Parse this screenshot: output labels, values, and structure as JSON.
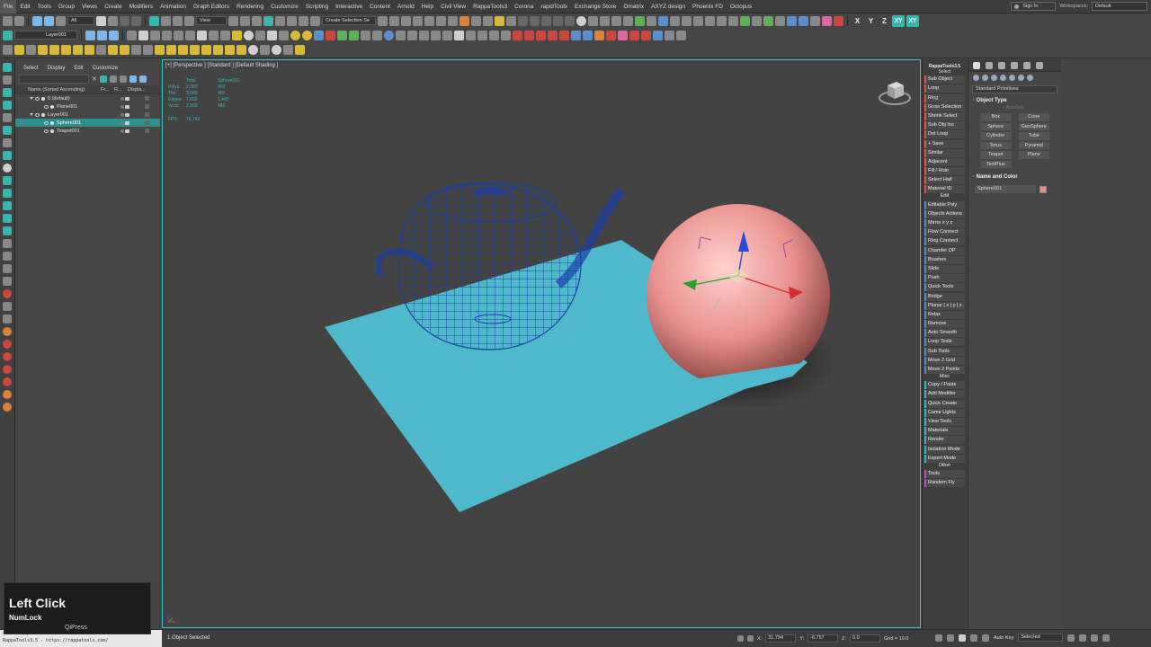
{
  "menu": [
    "File",
    "Edit",
    "Tools",
    "Group",
    "Views",
    "Create",
    "Modifiers",
    "Animation",
    "Graph Editors",
    "Rendering",
    "Customize",
    "Scripting",
    "Interactive",
    "Content",
    "Arnold",
    "Help",
    "Civil View",
    "RappaTools3",
    "Corona",
    "rapidTools",
    "Exchange Store",
    "Omatrix",
    "AXYZ design",
    "Phoenix FD",
    "Octopus"
  ],
  "account": {
    "sign_in": "Sign In",
    "workspaces_label": "Workspaces:",
    "workspace": "Default"
  },
  "toolbar": {
    "filter": "All",
    "ref_coord": "View",
    "selection_set": "Create Selection Se",
    "layer": "Layer001",
    "axes": [
      "X",
      "Y",
      "Z",
      "XY",
      "XY"
    ]
  },
  "explorer": {
    "menu": [
      "Select",
      "Display",
      "Edit",
      "Customize"
    ],
    "columns": {
      "name": "Name (Sorted Ascending)",
      "frozen": "Fr...",
      "render": "R...",
      "display": "Displa..."
    },
    "rows": [
      {
        "label": "0 (default)",
        "indent": 1,
        "selected": false
      },
      {
        "label": "Plane001",
        "indent": 2,
        "selected": false
      },
      {
        "label": "Layer001",
        "indent": 1,
        "selected": false
      },
      {
        "label": "Sphere001",
        "indent": 2,
        "selected": true
      },
      {
        "label": "Teapot001",
        "indent": 2,
        "selected": false
      }
    ]
  },
  "viewport": {
    "label": "[+] [Perspective ] [Standard ] [Default Shading ]",
    "stats": {
      "header": [
        "",
        "Total",
        "Sphere001"
      ],
      "rows": [
        [
          "Polys:",
          "2,080",
          "960"
        ],
        [
          "Tris:",
          "3,680",
          "960"
        ],
        [
          "Edges:",
          "7,600",
          "1,440"
        ],
        [
          "Verts:",
          "2,589",
          "482"
        ]
      ],
      "fps_label": "FPS:",
      "fps": "76.742"
    }
  },
  "rappa": {
    "title": "RappaTools3.5",
    "subtitle": "Select",
    "items": [
      {
        "type": "btn",
        "label": "Sub Object",
        "color": "red"
      },
      {
        "type": "btn",
        "label": "Loop",
        "color": "red"
      },
      {
        "type": "btn",
        "label": "Ring",
        "color": "red"
      },
      {
        "type": "btn",
        "label": "Grow Selection",
        "color": "red"
      },
      {
        "type": "btn",
        "label": "Shrink Select",
        "color": "red"
      },
      {
        "type": "btn",
        "label": "Sub Obj Iso",
        "color": "red"
      },
      {
        "type": "btn",
        "label": "Dot Loop",
        "color": "red"
      },
      {
        "type": "btn",
        "label": "+ Save",
        "color": "red"
      },
      {
        "type": "btn",
        "label": "Similar",
        "color": "red"
      },
      {
        "type": "btn",
        "label": "Adjacent",
        "color": "red"
      },
      {
        "type": "btn",
        "label": "Fill / Hole",
        "color": "red"
      },
      {
        "type": "btn",
        "label": "Select Half",
        "color": "red"
      },
      {
        "type": "btn",
        "label": "Material ID",
        "color": "red"
      },
      {
        "type": "sect",
        "label": "Edit"
      },
      {
        "type": "btn",
        "label": "Editable Poly",
        "color": "blue"
      },
      {
        "type": "btn",
        "label": "Objects Actions",
        "color": "blue"
      },
      {
        "type": "btn",
        "label": "Mirror   x  y  z",
        "color": "blue"
      },
      {
        "type": "btn",
        "label": "Flow Connect",
        "color": "blue"
      },
      {
        "type": "btn",
        "label": "Ring Connect",
        "color": "blue"
      },
      {
        "type": "btn",
        "label": "Chamfer OP",
        "color": "blue"
      },
      {
        "type": "btn",
        "label": "Brushes",
        "color": "blue"
      },
      {
        "type": "btn",
        "label": "Slide",
        "color": "blue"
      },
      {
        "type": "btn",
        "label": "Push",
        "color": "blue"
      },
      {
        "type": "btn",
        "label": "Quick Tools",
        "color": "blue"
      },
      {
        "type": "btn",
        "label": "Bridge",
        "color": "blue"
      },
      {
        "type": "btn",
        "label": "Planar | x | y | z",
        "color": "blue"
      },
      {
        "type": "btn",
        "label": "Relax",
        "color": "blue"
      },
      {
        "type": "btn",
        "label": "Remove",
        "color": "blue"
      },
      {
        "type": "btn",
        "label": "Auto Smooth",
        "color": "blue"
      },
      {
        "type": "btn",
        "label": "Loop Tools",
        "color": "blue"
      },
      {
        "type": "btn",
        "label": "Sub Tools",
        "color": "blue"
      },
      {
        "type": "btn",
        "label": "Move 2 Grid",
        "color": "blue"
      },
      {
        "type": "btn",
        "label": "Move 2 Points",
        "color": "blue"
      },
      {
        "type": "sect",
        "label": "Misc"
      },
      {
        "type": "btn",
        "label": "Copy / Paste",
        "color": "teal"
      },
      {
        "type": "btn",
        "label": "Add Modifier",
        "color": "teal"
      },
      {
        "type": "btn",
        "label": "Quick Create",
        "color": "teal"
      },
      {
        "type": "btn",
        "label": "Came Lights",
        "color": "teal"
      },
      {
        "type": "btn",
        "label": "View Tools",
        "color": "teal"
      },
      {
        "type": "btn",
        "label": "Materials",
        "color": "teal"
      },
      {
        "type": "btn",
        "label": "Render",
        "color": "teal"
      },
      {
        "type": "btn",
        "label": "Isolation Mode",
        "color": "teal"
      },
      {
        "type": "btn",
        "label": "Expert Mode",
        "color": "teal"
      },
      {
        "type": "sect",
        "label": "Other"
      },
      {
        "type": "btn",
        "label": "Tools",
        "color": "purple"
      },
      {
        "type": "btn",
        "label": "Random Fly",
        "color": "purple"
      }
    ]
  },
  "command_panel": {
    "category": "Standard Primitives",
    "object_type_title": "Object Type",
    "autogrid": "AutoGrid",
    "objects": [
      "Box",
      "Cone",
      "Sphere",
      "GeoSphere",
      "Cylinder",
      "Tube",
      "Torus",
      "Pyramid",
      "Teapot",
      "Plane",
      "TextPlus"
    ],
    "name_color_title": "Name and Color",
    "object_name": "Sphere001",
    "object_color": "#e98c8c"
  },
  "status": {
    "maxscript_line1": "select $Sphere001",
    "maxscript_line2": "RappaTools3.5 - https://rappatools.com/",
    "selected": "1 Object Selected",
    "x_label": "X:",
    "x": "31.794",
    "y_label": "Y:",
    "y": "-6.757",
    "z_label": "Z:",
    "z": "0.0",
    "grid": "Grid = 10.0",
    "auto_key": "Auto Key",
    "set_key_mode": "Selected"
  },
  "overlay": {
    "main": "Left Click",
    "sub": "NumLock",
    "brand": "QiPress"
  },
  "colors": {
    "accent": "#3bc4c4",
    "plane": "#4fb9cc",
    "sphere": "#e98c8c",
    "teapot_wire": "#1a3fa6",
    "viewport_bg": "#434343"
  }
}
